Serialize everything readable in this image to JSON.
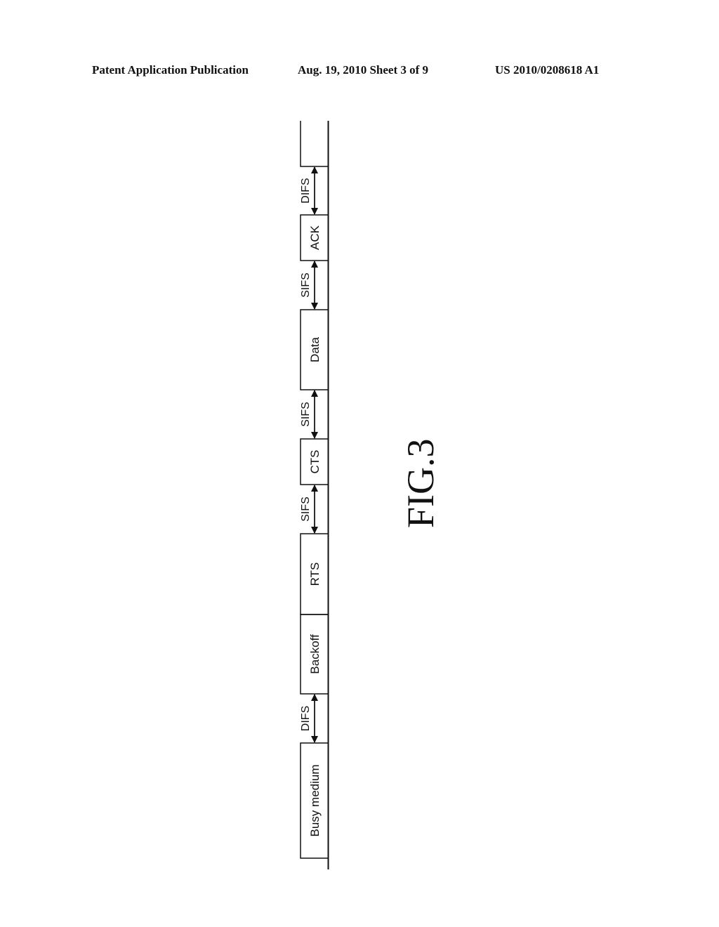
{
  "header": {
    "left": "Patent Application Publication",
    "middle": "Aug. 19, 2010  Sheet 3 of 9",
    "right": "US 2010/0208618 A1"
  },
  "figure": {
    "label": "FIG.3",
    "sequence": [
      {
        "kind": "box",
        "label": "Busy medium"
      },
      {
        "kind": "gap",
        "label": "DIFS"
      },
      {
        "kind": "box",
        "label": "Backoff"
      },
      {
        "kind": "box",
        "label": "RTS"
      },
      {
        "kind": "gap",
        "label": "SIFS"
      },
      {
        "kind": "box",
        "label": "CTS"
      },
      {
        "kind": "gap",
        "label": "SIFS"
      },
      {
        "kind": "box",
        "label": "Data"
      },
      {
        "kind": "gap",
        "label": "SIFS"
      },
      {
        "kind": "box",
        "label": "ACK"
      },
      {
        "kind": "gap",
        "label": "DIFS"
      },
      {
        "kind": "open-box",
        "label": ""
      }
    ]
  }
}
